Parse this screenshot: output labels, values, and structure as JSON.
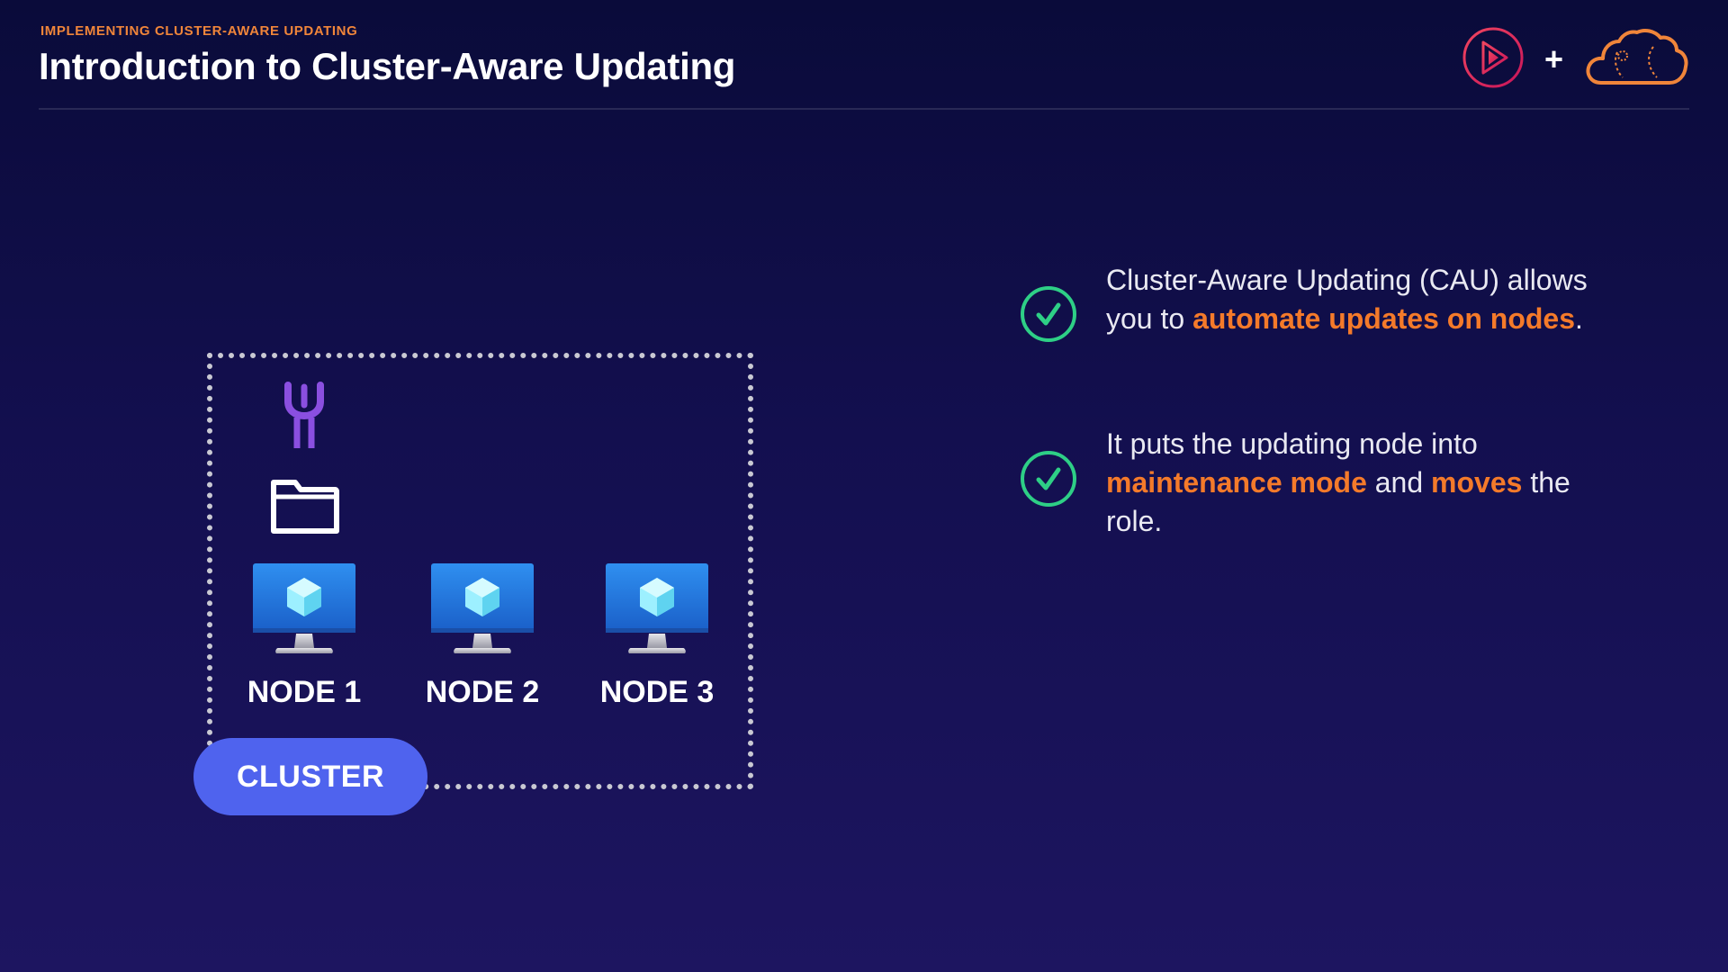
{
  "header": {
    "eyebrow": "IMPLEMENTING CLUSTER-AWARE UPDATING",
    "title": "Introduction to Cluster-Aware Updating",
    "plus": "+"
  },
  "brand": {
    "play_icon": "play-logo-icon",
    "cloud_icon": "cloud-logo-icon",
    "play_color": "#e1245a",
    "cloud_color": "#f0853a"
  },
  "diagram": {
    "tool_icon": "wrench-icon",
    "folder_icon": "folder-icon",
    "nodes": [
      {
        "label": "NODE 1",
        "icon": "monitor-icon"
      },
      {
        "label": "NODE 2",
        "icon": "monitor-icon"
      },
      {
        "label": "NODE 3",
        "icon": "monitor-icon"
      }
    ],
    "cluster_label": "CLUSTER",
    "cluster_color": "#4f63ee"
  },
  "bullets": [
    {
      "icon": "check-circle-icon",
      "parts": [
        {
          "text": "Cluster-Aware Updating (CAU) allows you to ",
          "highlight": false
        },
        {
          "text": "automate updates on nodes",
          "highlight": true
        },
        {
          "text": ".",
          "highlight": false
        }
      ]
    },
    {
      "icon": "check-circle-icon",
      "parts": [
        {
          "text": "It puts the updating node into ",
          "highlight": false
        },
        {
          "text": "maintenance mode",
          "highlight": true
        },
        {
          "text": " and ",
          "highlight": false
        },
        {
          "text": "moves",
          "highlight": true
        },
        {
          "text": " the role.",
          "highlight": false
        }
      ]
    }
  ],
  "colors": {
    "accent": "#f47a2a",
    "check": "#2ecf86",
    "background": "#130f4f"
  }
}
